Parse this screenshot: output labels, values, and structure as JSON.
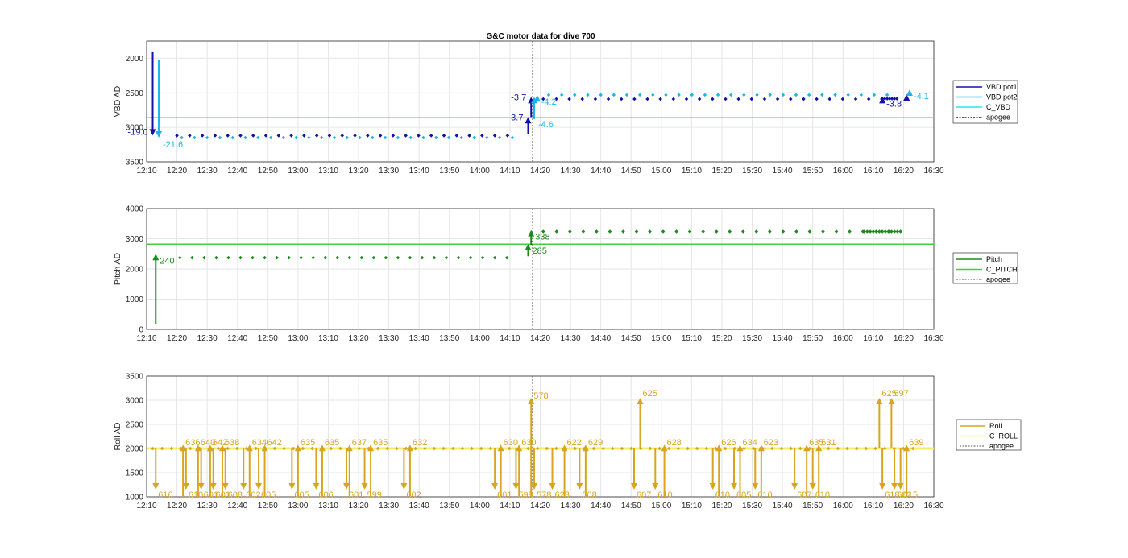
{
  "title": "G&C motor data for dive 700",
  "colors": {
    "vbd1": "#1212a6",
    "vbd2": "#18b6ea",
    "cvbd": "#2ee3ee",
    "pitch": "#1e8a1e",
    "cpitch": "#3fd13f",
    "roll": "#d9a520",
    "croll": "#f3ef6a",
    "apogee": "#555555",
    "grid": "#e6e6e6"
  },
  "x_ticks": [
    "12:10",
    "12:20",
    "12:30",
    "12:40",
    "12:50",
    "13:00",
    "13:10",
    "13:20",
    "13:30",
    "13:40",
    "13:50",
    "14:00",
    "14:10",
    "14:20",
    "14:30",
    "14:40",
    "14:50",
    "15:00",
    "15:10",
    "15:20",
    "15:30",
    "15:40",
    "15:50",
    "16:00",
    "16:10",
    "16:20",
    "16:30"
  ],
  "chart_data": [
    {
      "type": "scatter",
      "title": "G&C motor data for dive 700",
      "xlabel": "",
      "ylabel": "VBD AD",
      "xlim_minutes": [
        730,
        990
      ],
      "ylim": [
        1750,
        3500
      ],
      "y_reversed": true,
      "y_ticks": [
        "2000",
        "2500",
        "3000",
        "3500"
      ],
      "legend": [
        "VBD pot1",
        "VBD pot2",
        "C_VBD",
        "apogee"
      ],
      "legend_position": "right",
      "apogee_minute": 857.5,
      "c_value": 2860,
      "pot1_points_y": 3120,
      "pot2_points_y": 3150,
      "pot1_points_y_after": 2590,
      "pot2_points_y_after": 2530,
      "moves": [
        {
          "series": "VBD pot1",
          "start": "12:12",
          "y_from": 1900,
          "y_to": 3120,
          "label": "-19.0"
        },
        {
          "series": "VBD pot2",
          "start": "12:14",
          "y_from": 2020,
          "y_to": 3150,
          "label": "-21.6"
        },
        {
          "series": "VBD pot1",
          "start": "14:16",
          "y_from": 3100,
          "y_to": 2850,
          "label": "-3.7"
        },
        {
          "series": "VBD pot1",
          "start": "14:17",
          "y_from": 2850,
          "y_to": 2560,
          "label": "-3.7"
        },
        {
          "series": "VBD pot2",
          "start": "14:18",
          "y_from": 2880,
          "y_to": 2560,
          "label": "-4.6"
        },
        {
          "series": "VBD pot2",
          "start": "14:19",
          "y_from": 2620,
          "y_to": 2530,
          "label": "-4.2"
        },
        {
          "series": "VBD pot1",
          "start": "16:13",
          "y_from": 2590,
          "y_to": 2560,
          "label": "-3.8"
        },
        {
          "series": "VBD pot1",
          "start": "16:21",
          "y_from": 2580,
          "y_to": 2520,
          "label": ""
        },
        {
          "series": "VBD pot2",
          "start": "16:22",
          "y_from": 2530,
          "y_to": 2450,
          "label": "-4.1"
        }
      ]
    },
    {
      "type": "scatter",
      "xlabel": "",
      "ylabel": "Pitch AD",
      "xlim_minutes": [
        730,
        990
      ],
      "ylim": [
        0,
        4000
      ],
      "y_ticks": [
        "0",
        "1000",
        "2000",
        "3000",
        "4000"
      ],
      "legend": [
        "Pitch",
        "C_PITCH",
        "apogee"
      ],
      "legend_position": "right",
      "apogee_minute": 857.5,
      "c_value": 2820,
      "points_y_before": 2370,
      "points_y_after": 3240,
      "moves": [
        {
          "start": "12:13",
          "y_from": 160,
          "y_to": 2500,
          "label": "240"
        },
        {
          "start": "14:16",
          "y_from": 2420,
          "y_to": 2830,
          "label": "285"
        },
        {
          "start": "14:17",
          "y_from": 2800,
          "y_to": 3290,
          "label": "338"
        }
      ]
    },
    {
      "type": "scatter",
      "xlabel": "",
      "ylabel": "Roll AD",
      "xlim_minutes": [
        730,
        990
      ],
      "ylim": [
        1000,
        3500
      ],
      "y_ticks": [
        "1000",
        "1500",
        "2000",
        "2500",
        "3000",
        "3500"
      ],
      "legend": [
        "Roll",
        "C_ROLL",
        "apogee"
      ],
      "legend_position": "right",
      "apogee_minute": 857.5,
      "c_value": 2000,
      "points_y": 2000,
      "moves": [
        {
          "start": "12:13",
          "dir": "down",
          "label": "616"
        },
        {
          "start": "12:22",
          "dir": "up",
          "label": "636"
        },
        {
          "start": "12:23",
          "dir": "down",
          "label": "610"
        },
        {
          "start": "12:27",
          "dir": "up",
          "label": "640"
        },
        {
          "start": "12:28",
          "dir": "down",
          "label": "601"
        },
        {
          "start": "12:31",
          "dir": "up",
          "label": "642"
        },
        {
          "start": "12:32",
          "dir": "down",
          "label": "601"
        },
        {
          "start": "12:35",
          "dir": "up",
          "label": "638"
        },
        {
          "start": "12:36",
          "dir": "down",
          "label": "608"
        },
        {
          "start": "12:42",
          "dir": "down",
          "label": "602"
        },
        {
          "start": "12:44",
          "dir": "up",
          "label": "634"
        },
        {
          "start": "12:47",
          "dir": "down",
          "label": "605"
        },
        {
          "start": "12:49",
          "dir": "up",
          "label": "642"
        },
        {
          "start": "12:58",
          "dir": "down",
          "label": "605"
        },
        {
          "start": "13:00",
          "dir": "up",
          "label": "635"
        },
        {
          "start": "13:06",
          "dir": "down",
          "label": "606"
        },
        {
          "start": "13:08",
          "dir": "up",
          "label": "635"
        },
        {
          "start": "13:16",
          "dir": "down",
          "label": "601"
        },
        {
          "start": "13:17",
          "dir": "up",
          "label": "637"
        },
        {
          "start": "13:22",
          "dir": "down",
          "label": "599"
        },
        {
          "start": "13:24",
          "dir": "up",
          "label": "635"
        },
        {
          "start": "13:35",
          "dir": "down",
          "label": "602"
        },
        {
          "start": "13:37",
          "dir": "up",
          "label": "632"
        },
        {
          "start": "14:05",
          "dir": "down",
          "label": "601"
        },
        {
          "start": "14:07",
          "dir": "up",
          "label": "630"
        },
        {
          "start": "14:12",
          "dir": "down",
          "label": "598"
        },
        {
          "start": "14:13",
          "dir": "up",
          "label": "630"
        },
        {
          "start": "14:17",
          "dir": "up",
          "label": "578"
        },
        {
          "start": "14:18",
          "dir": "down",
          "label": "578"
        },
        {
          "start": "14:24",
          "dir": "down",
          "label": "623"
        },
        {
          "start": "14:28",
          "dir": "up",
          "label": "622"
        },
        {
          "start": "14:33",
          "dir": "down",
          "label": "608"
        },
        {
          "start": "14:35",
          "dir": "up",
          "label": "629"
        },
        {
          "start": "14:51",
          "dir": "down",
          "label": "607"
        },
        {
          "start": "14:53",
          "dir": "up",
          "label": "625"
        },
        {
          "start": "14:58",
          "dir": "down",
          "label": "610"
        },
        {
          "start": "15:01",
          "dir": "up",
          "label": "628"
        },
        {
          "start": "15:17",
          "dir": "down",
          "label": "610"
        },
        {
          "start": "15:19",
          "dir": "up",
          "label": "626"
        },
        {
          "start": "15:24",
          "dir": "down",
          "label": "605"
        },
        {
          "start": "15:26",
          "dir": "up",
          "label": "634"
        },
        {
          "start": "15:31",
          "dir": "down",
          "label": "610"
        },
        {
          "start": "15:33",
          "dir": "up",
          "label": "623"
        },
        {
          "start": "15:44",
          "dir": "down",
          "label": "607"
        },
        {
          "start": "15:48",
          "dir": "up",
          "label": "635"
        },
        {
          "start": "15:50",
          "dir": "down",
          "label": "610"
        },
        {
          "start": "15:52",
          "dir": "up",
          "label": "631"
        },
        {
          "start": "16:12",
          "dir": "up",
          "label": "625"
        },
        {
          "start": "16:13",
          "dir": "down",
          "label": "618"
        },
        {
          "start": "16:16",
          "dir": "up",
          "label": "597"
        },
        {
          "start": "16:17",
          "dir": "down",
          "label": "602"
        },
        {
          "start": "16:19",
          "dir": "down",
          "label": "615"
        },
        {
          "start": "16:21",
          "dir": "up",
          "label": "639"
        }
      ]
    }
  ]
}
